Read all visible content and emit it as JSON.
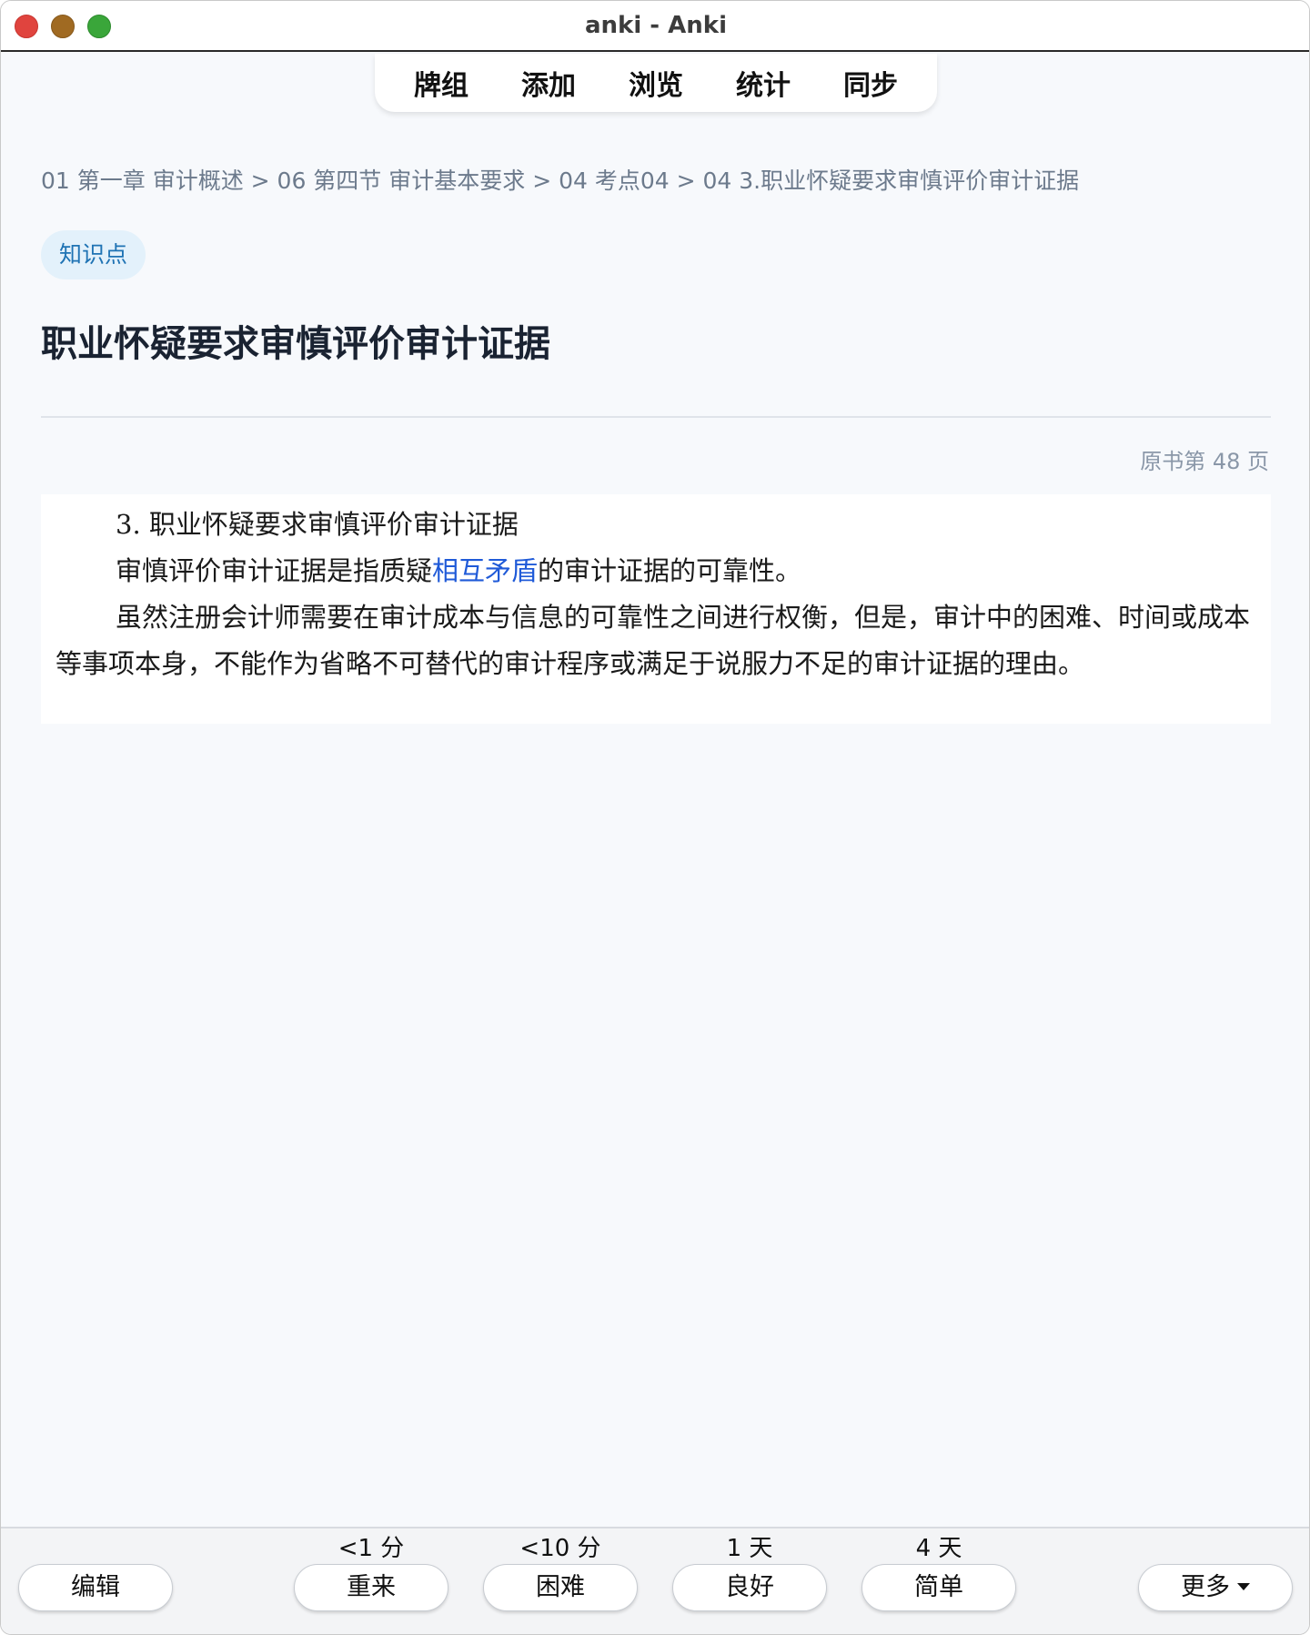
{
  "window": {
    "title": "anki - Anki"
  },
  "topnav": {
    "items": [
      "牌组",
      "添加",
      "浏览",
      "统计",
      "同步"
    ]
  },
  "card": {
    "breadcrumb": "01 第一章 审计概述 > 06 第四节 审计基本要求 > 04 考点04 > 04 3.职业怀疑要求审慎评价审计证据",
    "tag": "知识点",
    "title": "职业怀疑要求审慎评价审计证据",
    "page_ref": "原书第 48 页",
    "scan": {
      "heading": "3. 职业怀疑要求审慎评价审计证据",
      "line2_before": "审慎评价审计证据是指质疑",
      "line2_highlight": "相互矛盾",
      "line2_after": "的审计证据的可靠性。",
      "paragraph": "虽然注册会计师需要在审计成本与信息的可靠性之间进行权衡，但是，审计中的困难、时间或成本等事项本身，不能作为省略不可替代的审计程序或满足于说服力不足的审计证据的理由。"
    }
  },
  "bottombar": {
    "edit_label": "编辑",
    "more_label": "更多",
    "answers": [
      {
        "label": "重来",
        "interval": "<1 分"
      },
      {
        "label": "困难",
        "interval": "<10 分"
      },
      {
        "label": "良好",
        "interval": "1 天"
      },
      {
        "label": "简单",
        "interval": "4 天"
      }
    ]
  },
  "colors": {
    "tag_bg": "#e3f1fb",
    "tag_text": "#1f73b4",
    "highlight": "#1f5ad8",
    "close": "#e0443e",
    "minimize": "#a06a22",
    "maximize": "#3aa63a"
  }
}
